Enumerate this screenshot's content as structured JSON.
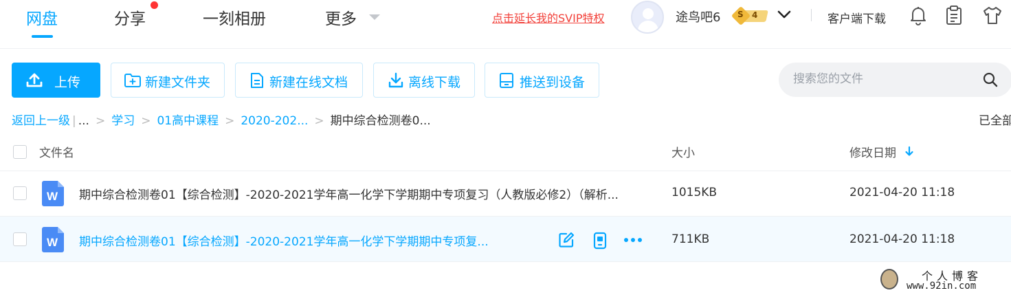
{
  "nav": {
    "tabs": [
      {
        "label": "网盘",
        "active": true
      },
      {
        "label": "分享",
        "has_notification_dot": true
      },
      {
        "label": "一刻相册"
      },
      {
        "label": "更多"
      }
    ]
  },
  "header": {
    "svip_link": "点击延长我的SVIP特权",
    "username": "途鸟吧6",
    "vip_badge": {
      "letter": "S",
      "level": "4"
    },
    "client_download": "客户端下载",
    "icons": [
      "bell-icon",
      "clipboard-icon",
      "tshirt-icon"
    ]
  },
  "toolbar": {
    "upload": "上传",
    "new_folder": "新建文件夹",
    "new_online_doc": "新建在线文档",
    "offline_download": "离线下载",
    "push_to_device": "推送到设备"
  },
  "search": {
    "placeholder": "搜索您的文件"
  },
  "breadcrumb": {
    "back": "返回上一级",
    "ellipsis": "...",
    "items": [
      "学习",
      "01高中课程",
      "2020-202..."
    ],
    "current": "期中综合检测卷0...",
    "loaded_all": "已全部"
  },
  "table": {
    "headers": {
      "name": "文件名",
      "size": "大小",
      "modified": "修改日期"
    },
    "rows": [
      {
        "name": "期中综合检测卷01【综合检测】-2020-2021学年高一化学下学期期中专项复习（人教版必修2）（解析...",
        "size": "1015KB",
        "modified": "2021-04-20 11:18"
      },
      {
        "name": "期中综合检测卷01【综合检测】-2020-2021学年高一化学下学期期中专项复...",
        "size": "711KB",
        "modified": "2021-04-20 11:18"
      }
    ]
  },
  "watermark": {
    "title": "个人博客",
    "url": "www.92in.com"
  },
  "colors": {
    "accent": "#06a7ff",
    "svip_red": "#f2413a",
    "word_blue": "#4a8bf5"
  }
}
